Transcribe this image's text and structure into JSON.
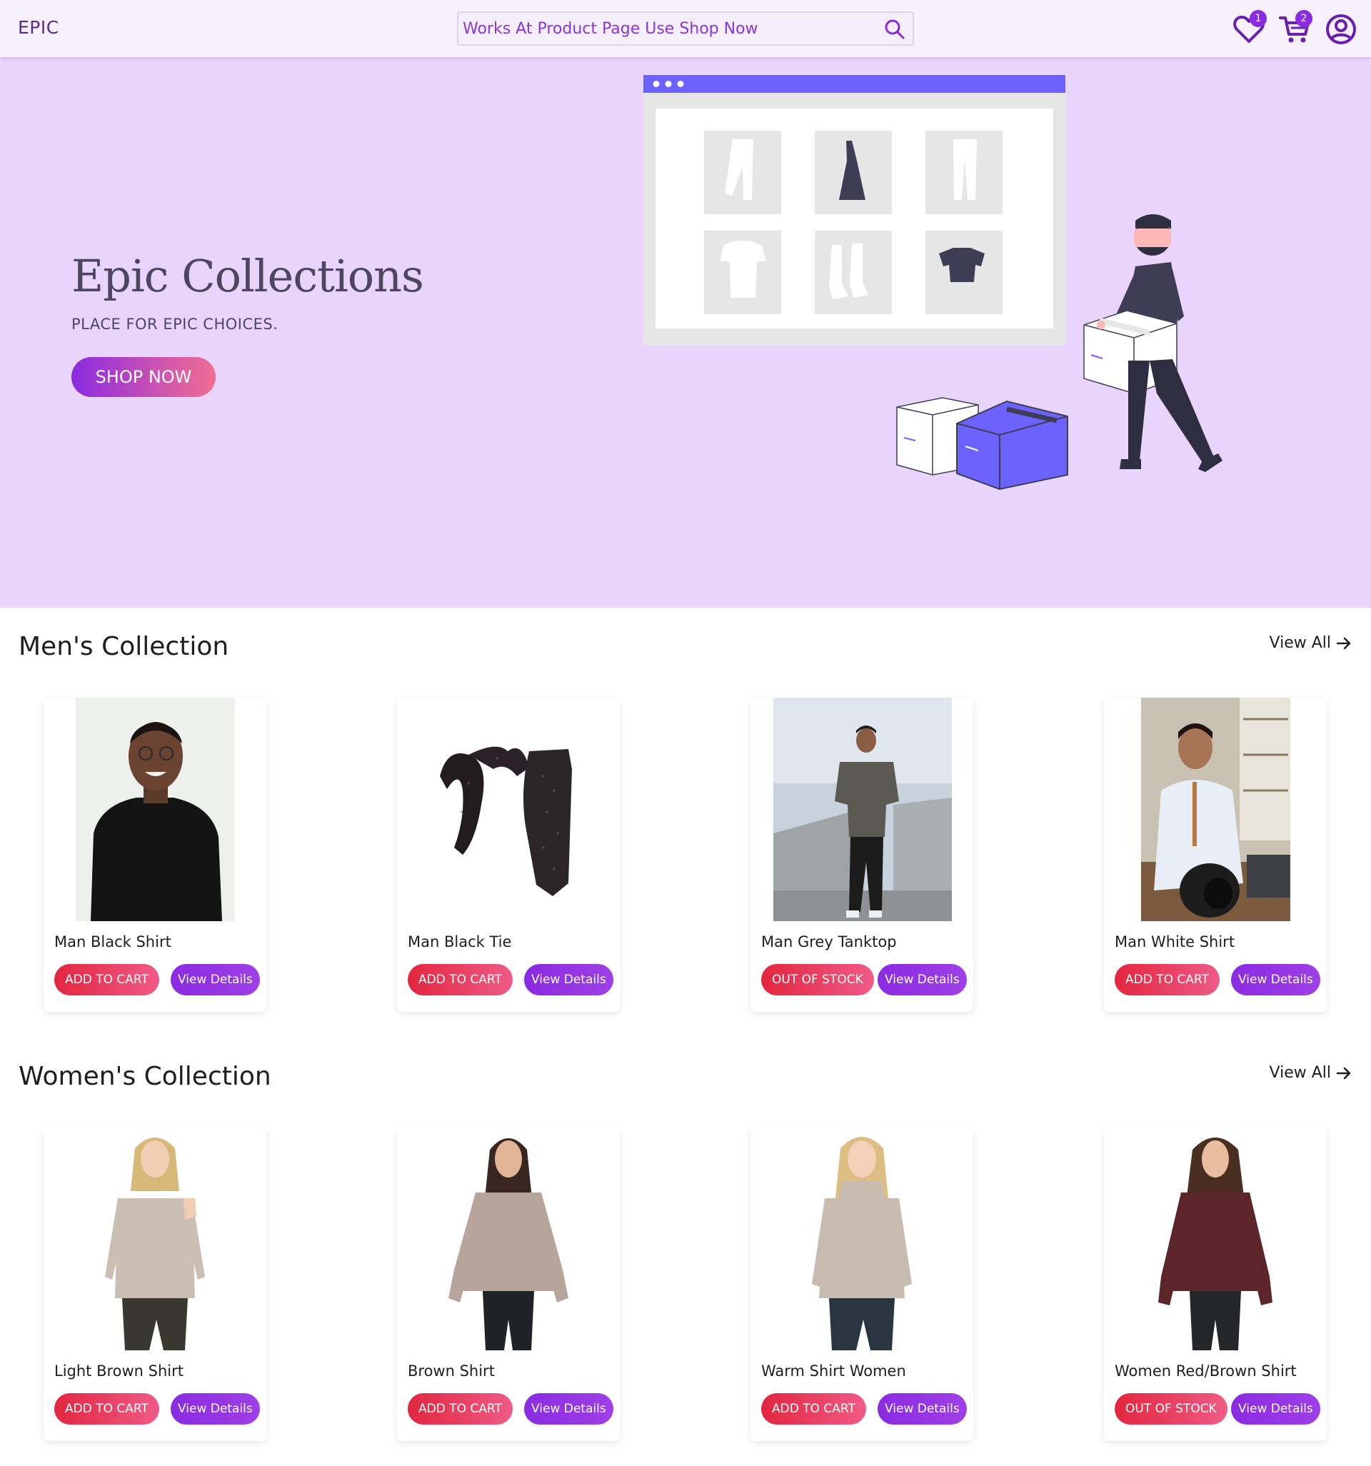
{
  "navbar": {
    "brand": "EPIC",
    "search_placeholder": "Works At Product Page Use Shop Now",
    "wishlist_count": "1",
    "cart_count": "2"
  },
  "hero": {
    "title": "Epic Collections",
    "subtitle": "PLACE FOR EPIC CHOICES.",
    "cta": "SHOP NOW"
  },
  "men": {
    "title": "Men's Collection",
    "view_all": "View All",
    "products": [
      {
        "name": "Man Black Shirt",
        "stock_label": "ADD TO CART",
        "details_label": "View Details"
      },
      {
        "name": "Man Black Tie",
        "stock_label": "ADD TO CART",
        "details_label": "View Details"
      },
      {
        "name": "Man Grey Tanktop",
        "stock_label": "OUT OF STOCK",
        "details_label": "View Details"
      },
      {
        "name": "Man White Shirt",
        "stock_label": "ADD TO CART",
        "details_label": "View Details"
      }
    ]
  },
  "women": {
    "title": "Women's Collection",
    "view_all": "View All",
    "products": [
      {
        "name": "Light Brown Shirt",
        "stock_label": "ADD TO CART",
        "details_label": "View Details"
      },
      {
        "name": "Brown Shirt",
        "stock_label": "ADD TO CART",
        "details_label": "View Details"
      },
      {
        "name": "Warm Shirt Women",
        "stock_label": "ADD TO CART",
        "details_label": "View Details"
      },
      {
        "name": "Women Red/Brown Shirt",
        "stock_label": "OUT OF STOCK",
        "details_label": "View Details"
      }
    ]
  },
  "colors": {
    "accent": "#8a2be2",
    "hero_bg": "#e9d5fb",
    "navbar_bg": "#f7f0fd",
    "cart_button": "#e2263f"
  },
  "icons": [
    "search-icon",
    "heart-icon",
    "cart-icon",
    "user-icon",
    "arrow-right-icon"
  ]
}
